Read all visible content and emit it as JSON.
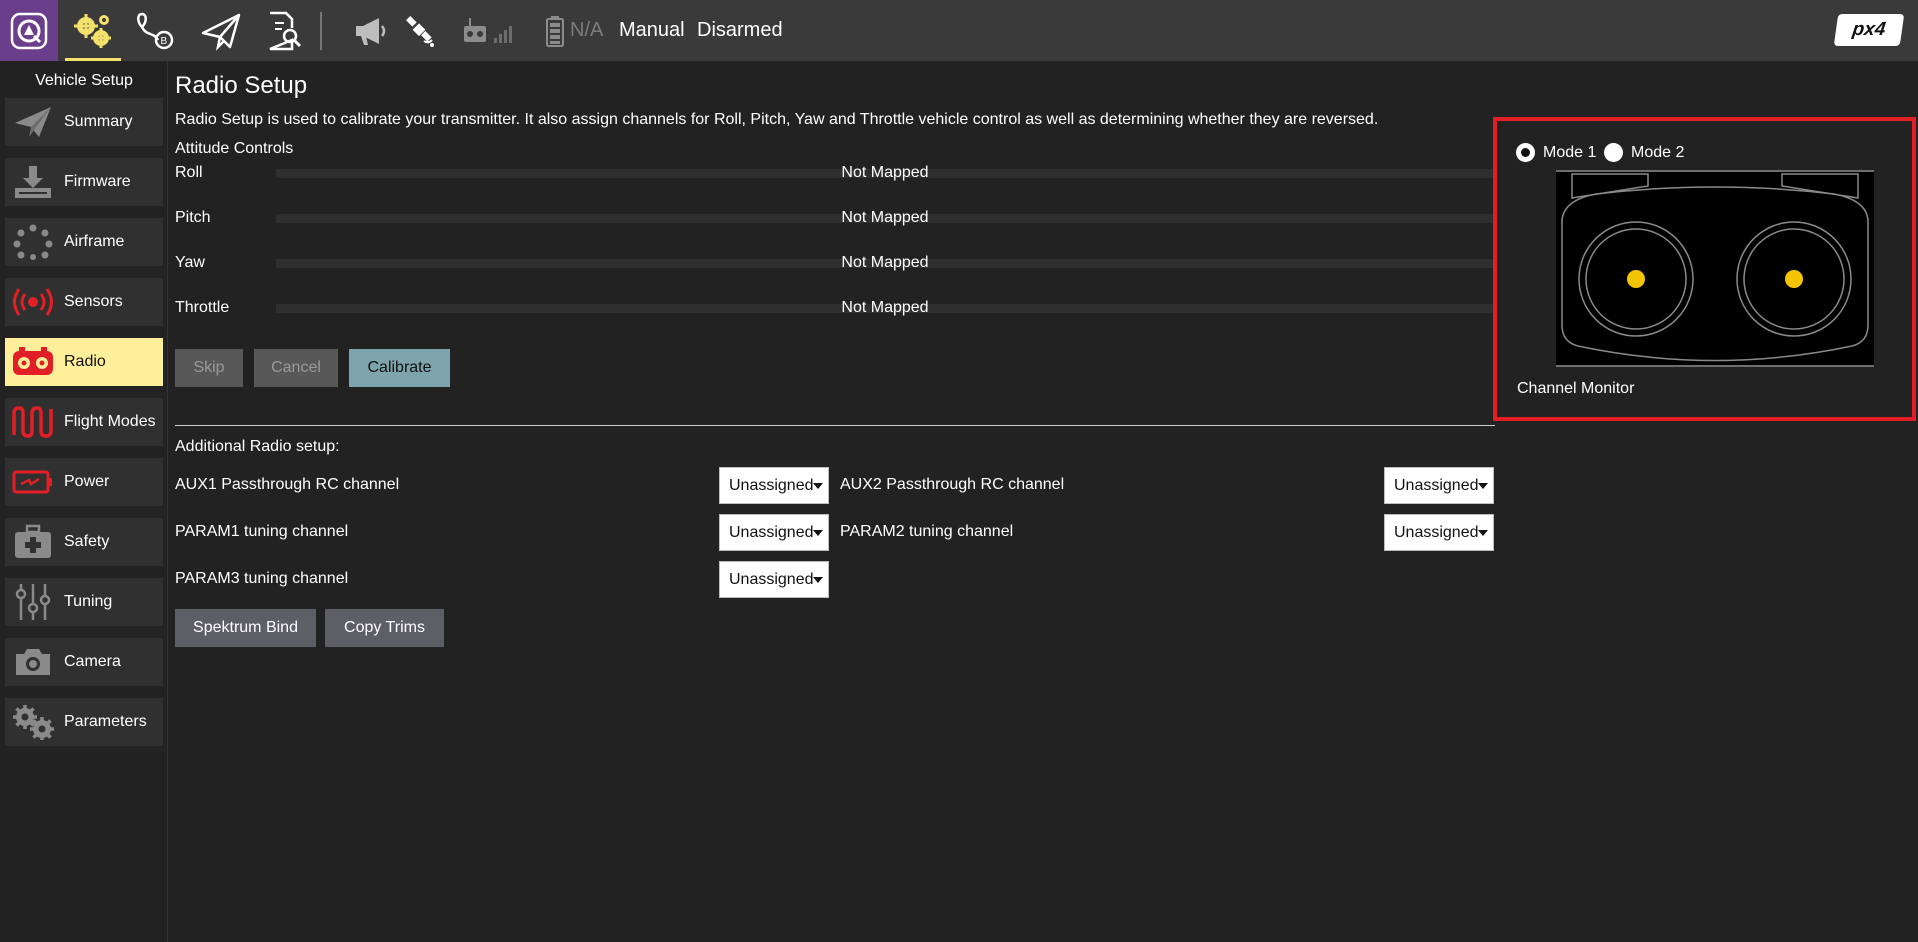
{
  "toolbar": {
    "battery_text": "N/A",
    "flight_mode": "Manual",
    "arm_status": "Disarmed",
    "logo_text": "px4",
    "icons": [
      "qgc-logo-icon",
      "vehicle-setup-gear-icon",
      "plan-waypoint-icon",
      "fly-paper-plane-icon",
      "analyze-icon",
      "messages-megaphone-icon",
      "gps-satellite-icon",
      "rc-transmitter-icon",
      "signal-bars-icon",
      "battery-icon"
    ]
  },
  "sidebar": {
    "title": "Vehicle Setup",
    "items": [
      {
        "label": "Summary",
        "icon": "paper-plane-icon"
      },
      {
        "label": "Firmware",
        "icon": "download-icon"
      },
      {
        "label": "Airframe",
        "icon": "airframe-icon"
      },
      {
        "label": "Sensors",
        "icon": "sensors-icon"
      },
      {
        "label": "Radio",
        "icon": "radio-icon",
        "active": true
      },
      {
        "label": "Flight Modes",
        "icon": "flight-modes-icon"
      },
      {
        "label": "Power",
        "icon": "power-icon"
      },
      {
        "label": "Safety",
        "icon": "safety-kit-icon"
      },
      {
        "label": "Tuning",
        "icon": "tuning-sliders-icon"
      },
      {
        "label": "Camera",
        "icon": "camera-icon"
      },
      {
        "label": "Parameters",
        "icon": "parameters-gears-icon"
      }
    ]
  },
  "main": {
    "title": "Radio Setup",
    "description": "Radio Setup is used to calibrate your transmitter. It also assign channels for Roll, Pitch, Yaw and Throttle vehicle control as well as determining whether they are reversed.",
    "attitude_title": "Attitude Controls",
    "attitude": [
      {
        "label": "Roll",
        "value": "Not Mapped"
      },
      {
        "label": "Pitch",
        "value": "Not Mapped"
      },
      {
        "label": "Yaw",
        "value": "Not Mapped"
      },
      {
        "label": "Throttle",
        "value": "Not Mapped"
      }
    ],
    "buttons": {
      "skip": "Skip",
      "cancel": "Cancel",
      "calibrate": "Calibrate"
    },
    "additional_title": "Additional Radio setup:",
    "options": [
      {
        "label": "AUX1 Passthrough RC channel",
        "value": "Unassigned"
      },
      {
        "label": "AUX2 Passthrough RC channel",
        "value": "Unassigned"
      },
      {
        "label": "PARAM1 tuning channel",
        "value": "Unassigned"
      },
      {
        "label": "PARAM2 tuning channel",
        "value": "Unassigned"
      },
      {
        "label": "PARAM3 tuning channel",
        "value": "Unassigned"
      }
    ],
    "spektrum_bind": "Spektrum Bind",
    "copy_trims": "Copy Trims"
  },
  "monitor": {
    "mode1_label": "Mode 1",
    "mode2_label": "Mode 2",
    "selected_mode": "Mode 1",
    "label": "Channel Monitor",
    "highlight_color": "#e21e26",
    "stick_color": "#f5c400"
  }
}
